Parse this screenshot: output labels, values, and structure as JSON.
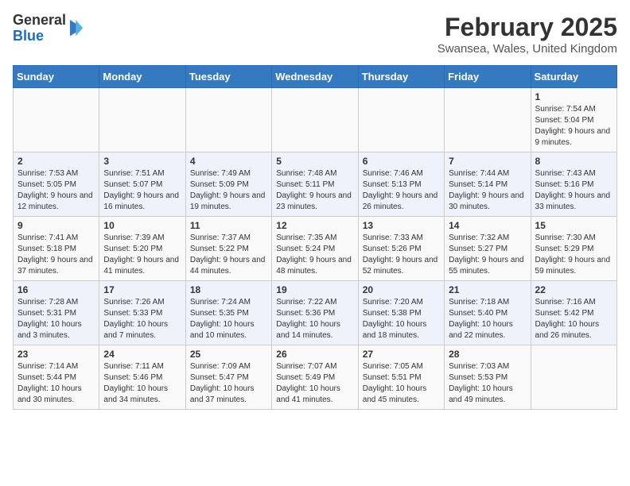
{
  "header": {
    "logo_general": "General",
    "logo_blue": "Blue",
    "month_year": "February 2025",
    "location": "Swansea, Wales, United Kingdom"
  },
  "days_of_week": [
    "Sunday",
    "Monday",
    "Tuesday",
    "Wednesday",
    "Thursday",
    "Friday",
    "Saturday"
  ],
  "weeks": [
    [
      {
        "day": "",
        "info": ""
      },
      {
        "day": "",
        "info": ""
      },
      {
        "day": "",
        "info": ""
      },
      {
        "day": "",
        "info": ""
      },
      {
        "day": "",
        "info": ""
      },
      {
        "day": "",
        "info": ""
      },
      {
        "day": "1",
        "info": "Sunrise: 7:54 AM\nSunset: 5:04 PM\nDaylight: 9 hours and 9 minutes."
      }
    ],
    [
      {
        "day": "2",
        "info": "Sunrise: 7:53 AM\nSunset: 5:05 PM\nDaylight: 9 hours and 12 minutes."
      },
      {
        "day": "3",
        "info": "Sunrise: 7:51 AM\nSunset: 5:07 PM\nDaylight: 9 hours and 16 minutes."
      },
      {
        "day": "4",
        "info": "Sunrise: 7:49 AM\nSunset: 5:09 PM\nDaylight: 9 hours and 19 minutes."
      },
      {
        "day": "5",
        "info": "Sunrise: 7:48 AM\nSunset: 5:11 PM\nDaylight: 9 hours and 23 minutes."
      },
      {
        "day": "6",
        "info": "Sunrise: 7:46 AM\nSunset: 5:13 PM\nDaylight: 9 hours and 26 minutes."
      },
      {
        "day": "7",
        "info": "Sunrise: 7:44 AM\nSunset: 5:14 PM\nDaylight: 9 hours and 30 minutes."
      },
      {
        "day": "8",
        "info": "Sunrise: 7:43 AM\nSunset: 5:16 PM\nDaylight: 9 hours and 33 minutes."
      }
    ],
    [
      {
        "day": "9",
        "info": "Sunrise: 7:41 AM\nSunset: 5:18 PM\nDaylight: 9 hours and 37 minutes."
      },
      {
        "day": "10",
        "info": "Sunrise: 7:39 AM\nSunset: 5:20 PM\nDaylight: 9 hours and 41 minutes."
      },
      {
        "day": "11",
        "info": "Sunrise: 7:37 AM\nSunset: 5:22 PM\nDaylight: 9 hours and 44 minutes."
      },
      {
        "day": "12",
        "info": "Sunrise: 7:35 AM\nSunset: 5:24 PM\nDaylight: 9 hours and 48 minutes."
      },
      {
        "day": "13",
        "info": "Sunrise: 7:33 AM\nSunset: 5:26 PM\nDaylight: 9 hours and 52 minutes."
      },
      {
        "day": "14",
        "info": "Sunrise: 7:32 AM\nSunset: 5:27 PM\nDaylight: 9 hours and 55 minutes."
      },
      {
        "day": "15",
        "info": "Sunrise: 7:30 AM\nSunset: 5:29 PM\nDaylight: 9 hours and 59 minutes."
      }
    ],
    [
      {
        "day": "16",
        "info": "Sunrise: 7:28 AM\nSunset: 5:31 PM\nDaylight: 10 hours and 3 minutes."
      },
      {
        "day": "17",
        "info": "Sunrise: 7:26 AM\nSunset: 5:33 PM\nDaylight: 10 hours and 7 minutes."
      },
      {
        "day": "18",
        "info": "Sunrise: 7:24 AM\nSunset: 5:35 PM\nDaylight: 10 hours and 10 minutes."
      },
      {
        "day": "19",
        "info": "Sunrise: 7:22 AM\nSunset: 5:36 PM\nDaylight: 10 hours and 14 minutes."
      },
      {
        "day": "20",
        "info": "Sunrise: 7:20 AM\nSunset: 5:38 PM\nDaylight: 10 hours and 18 minutes."
      },
      {
        "day": "21",
        "info": "Sunrise: 7:18 AM\nSunset: 5:40 PM\nDaylight: 10 hours and 22 minutes."
      },
      {
        "day": "22",
        "info": "Sunrise: 7:16 AM\nSunset: 5:42 PM\nDaylight: 10 hours and 26 minutes."
      }
    ],
    [
      {
        "day": "23",
        "info": "Sunrise: 7:14 AM\nSunset: 5:44 PM\nDaylight: 10 hours and 30 minutes."
      },
      {
        "day": "24",
        "info": "Sunrise: 7:11 AM\nSunset: 5:46 PM\nDaylight: 10 hours and 34 minutes."
      },
      {
        "day": "25",
        "info": "Sunrise: 7:09 AM\nSunset: 5:47 PM\nDaylight: 10 hours and 37 minutes."
      },
      {
        "day": "26",
        "info": "Sunrise: 7:07 AM\nSunset: 5:49 PM\nDaylight: 10 hours and 41 minutes."
      },
      {
        "day": "27",
        "info": "Sunrise: 7:05 AM\nSunset: 5:51 PM\nDaylight: 10 hours and 45 minutes."
      },
      {
        "day": "28",
        "info": "Sunrise: 7:03 AM\nSunset: 5:53 PM\nDaylight: 10 hours and 49 minutes."
      },
      {
        "day": "",
        "info": ""
      }
    ]
  ]
}
